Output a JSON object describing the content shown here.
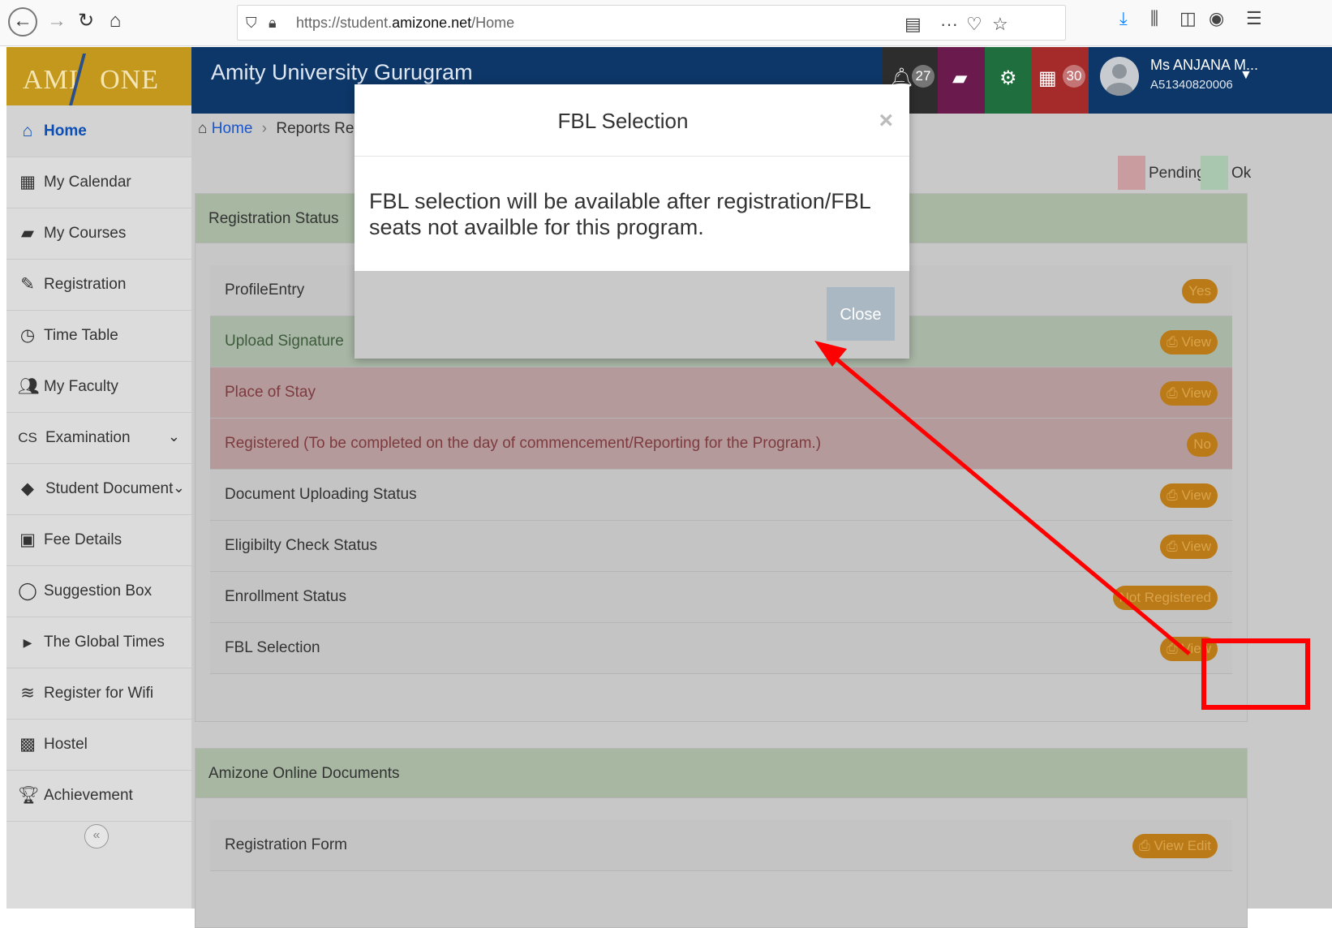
{
  "browser": {
    "url_prefix": "https://student.",
    "url_domain": "amizone.net",
    "url_path": "/Home"
  },
  "app": {
    "logo_left": "AMI",
    "logo_right": "ONE",
    "university": "Amity University Gurugram",
    "notifications_count": "27",
    "calendar_count": "30",
    "user_name": "Ms ANJANA M...",
    "user_id": "A51340820006"
  },
  "sidebar": {
    "items": [
      {
        "label": "Home",
        "icon": "home-icon"
      },
      {
        "label": "My Calendar",
        "icon": "calendar-icon"
      },
      {
        "label": "My Courses",
        "icon": "book-icon"
      },
      {
        "label": "Registration",
        "icon": "edit-icon"
      },
      {
        "label": "Time Table",
        "icon": "clock-icon"
      },
      {
        "label": "My Faculty",
        "icon": "users-icon"
      },
      {
        "label": "Examination",
        "icon": "exam-icon"
      },
      {
        "label": "Student Document",
        "icon": "tag-icon"
      },
      {
        "label": "Fee Details",
        "icon": "money-icon"
      },
      {
        "label": "Suggestion Box",
        "icon": "comment-icon"
      },
      {
        "label": "The Global Times",
        "icon": "caret-right-icon"
      },
      {
        "label": "Register for Wifi",
        "icon": "wifi-icon"
      },
      {
        "label": "Hostel",
        "icon": "hostel-icon"
      },
      {
        "label": "Achievement",
        "icon": "trophy-icon"
      }
    ]
  },
  "main": {
    "breadcrumb_home": "Home",
    "breadcrumb_current": "Reports Regis",
    "legend_pending": "Pending",
    "legend_ok": "Ok",
    "registration_panel": {
      "title": "Registration Status",
      "rows": [
        {
          "label": "ProfileEntry",
          "badge": "Yes"
        },
        {
          "label": "Upload Signature",
          "badge": "View"
        },
        {
          "label": "Place of Stay",
          "badge": "View"
        },
        {
          "label": "Registered (To be completed on the day of commencement/Reporting for the Program.)",
          "badge": "No"
        },
        {
          "label": "Document Uploading Status",
          "badge": "View"
        },
        {
          "label": "Eligibilty Check Status",
          "badge": "View"
        },
        {
          "label": "Enrollment Status",
          "badge": "Not Registered"
        },
        {
          "label": "FBL Selection",
          "badge": "View"
        }
      ]
    },
    "documents_panel": {
      "title": "Amizone Online Documents",
      "rows": [
        {
          "label": "Registration Form",
          "badge": "View Edit"
        }
      ]
    }
  },
  "modal": {
    "title": "FBL Selection",
    "close_x": "×",
    "message": "FBL selection will be available after registration/FBL seats not availble for this program.",
    "close_button": "Close"
  },
  "annotation": {
    "color": "#ff0000"
  }
}
